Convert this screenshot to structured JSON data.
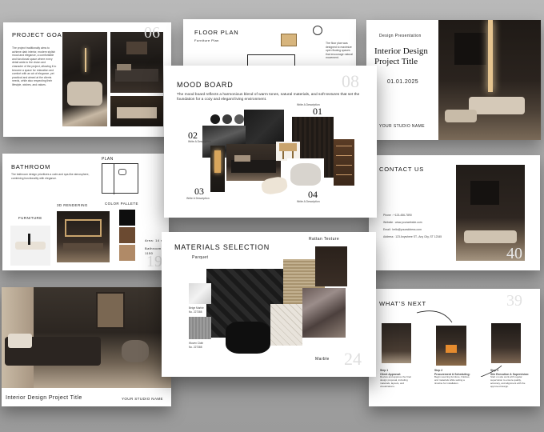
{
  "colors": {
    "background": "#a6a6a6",
    "slide": "#ffffff",
    "dark": "#1c1916",
    "wood": "#6b4a31",
    "beige": "#cdbba2"
  },
  "slides": {
    "project_goals": {
      "title": "PROJECT GOALS",
      "number": "06",
      "body": "The project traditionally aims to achieve dark interior, modern stylish mood and elegance, a comfortable and functional space where every detail adds to the vision and character of the project, allowing it to become a space for relaxation and comfort with an air of elegance, yet practical and aimed at the clients needs, while also respecting their lifestyle, wishes, and values."
    },
    "floor_plan": {
      "title": "FLOOR PLAN",
      "subtitle": "Furniture Plan",
      "note": "The floor plan was designed to maximize open flowing spaces that encourage natural movement."
    },
    "cover": {
      "label": "Design Presentation",
      "title_line1": "Interior Design",
      "title_line2": "Project Title",
      "date": "01.01.2025",
      "studio": "YOUR STUDIO NAME"
    },
    "mood_board": {
      "title": "MOOD BOARD",
      "number": "08",
      "body": "The mood board reflects a harmonious blend of warm tones, natural materials, and soft textures that set the foundation for a cozy and elegant living environment.",
      "items": [
        {
          "num": "01",
          "caption": "Write A Description"
        },
        {
          "num": "02",
          "caption": "Write A Description"
        },
        {
          "num": "03",
          "caption": "Write A Description"
        },
        {
          "num": "04",
          "caption": "Write A Description"
        }
      ],
      "palette": [
        "#1a1a1a",
        "#3b3b3b",
        "#5a5a5a",
        "#8a8a8a",
        "#6b4a31"
      ]
    },
    "bathroom": {
      "title": "BATHROOM",
      "plan_label": "PLAN",
      "furniture_label": "FURNITURE",
      "rendering_label": "3D RENDERING",
      "palette_label": "COLOR PALLETE",
      "number": "19",
      "body": "The bathroom design prioritizes a calm and spa-like atmosphere, combining functionality with elegance.",
      "area_label": "Area: 14 m",
      "bathroom_label": "Bathroom",
      "bathroom_value": "1150",
      "palette": [
        "#0e0e0e",
        "#6b4a31",
        "#b08a67"
      ]
    },
    "contact": {
      "title": "CONTACT US",
      "number": "40",
      "phone": "Phone : +123-456-7890",
      "website": "Website : www.yourwebsite.com",
      "email": "Email : hello@youraddress.com",
      "address": "Address : 123 Anywhere ST., Any City, ST 12345"
    },
    "materials": {
      "title": "MATERIALS SELECTION",
      "number": "24",
      "labels": {
        "parquet": "Parquet",
        "rattan": "Rattan Texture",
        "marble": "Marble"
      },
      "swatch_captions": [
        {
          "name": "Beige Marble",
          "code": "No. 227388"
        },
        {
          "name": "Woven Cloth",
          "code": "No. 227388"
        }
      ]
    },
    "render": {
      "title": "Interior Design Project Title",
      "studio": "YOUR STUDIO NAME"
    },
    "next": {
      "title": "WHAT'S NEXT",
      "number": "39",
      "steps": [
        {
          "label": "Step 1",
          "title": "Client Approval:",
          "text": "Review and approve the final design proposal, including materials, layouts, and visualizations."
        },
        {
          "label": "Step 2",
          "title": "Procurement & Scheduling:",
          "text": "Begin sourcing furniture, finishes, and materials while setting a timeline for installation."
        },
        {
          "label": "Step 3",
          "title": "Site Execution & Supervision:",
          "text": "Start on-site work with regular supervision to ensure quality, accuracy, and alignment with the approved design."
        }
      ]
    }
  }
}
